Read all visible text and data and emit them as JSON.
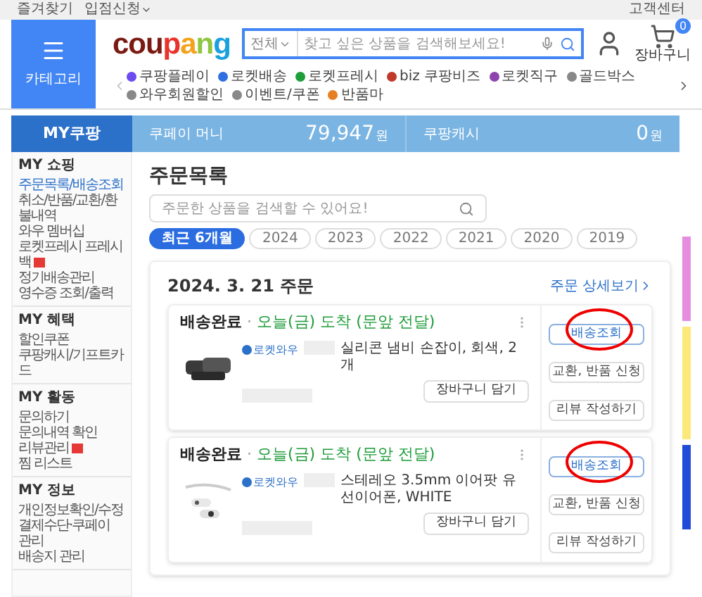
{
  "top_bar": {
    "links": [
      "즐겨찾기",
      "입점신청"
    ],
    "right": "고객센터"
  },
  "header": {
    "menu_label": "카테고리",
    "logo": "coupang",
    "search": {
      "category": "전체",
      "placeholder": "찾고 싶은 상품을 검색해보세요!"
    },
    "cart": {
      "label": "장바구니",
      "badge": "0"
    },
    "nav": [
      "쿠팡플레이",
      "로켓배송",
      "로켓프레시",
      "biz 쿠팡비즈",
      "로켓직구",
      "골드박스",
      "와우회원할인",
      "이벤트/쿠폰",
      "반품마"
    ]
  },
  "my_bar": {
    "title": "MY쿠팡",
    "stats": [
      {
        "label": "쿠페이 머니",
        "value": "79,947",
        "unit": "원"
      },
      {
        "label": "쿠팡캐시",
        "value": "0",
        "unit": "원"
      }
    ]
  },
  "sidebar": [
    {
      "title": "MY 쇼핑",
      "items": [
        {
          "label": "주문목록/배송조회",
          "selected": true,
          "new": false
        },
        {
          "label": "취소/반품/교환/환불내역",
          "selected": false,
          "new": false
        },
        {
          "label": "와우 멤버십",
          "selected": false,
          "new": false
        },
        {
          "label": "로켓프레시 프레시백",
          "selected": false,
          "new": true
        },
        {
          "label": "정기배송관리",
          "selected": false,
          "new": false
        },
        {
          "label": "영수증 조회/출력",
          "selected": false,
          "new": false
        }
      ]
    },
    {
      "title": "MY 혜택",
      "items": [
        {
          "label": "할인쿠폰",
          "selected": false,
          "new": false
        },
        {
          "label": "쿠팡캐시/기프트카드",
          "selected": false,
          "new": false
        }
      ]
    },
    {
      "title": "MY 활동",
      "items": [
        {
          "label": "문의하기",
          "selected": false,
          "new": false
        },
        {
          "label": "문의내역 확인",
          "selected": false,
          "new": false
        },
        {
          "label": "리뷰관리",
          "selected": false,
          "new": true
        },
        {
          "label": "찜 리스트",
          "selected": false,
          "new": false
        }
      ]
    },
    {
      "title": "MY 정보",
      "items": [
        {
          "label": "개인정보확인/수정",
          "selected": false,
          "new": false
        },
        {
          "label": "결제수단·쿠페이 관리",
          "selected": false,
          "new": false
        },
        {
          "label": "배송지 관리",
          "selected": false,
          "new": false
        }
      ]
    }
  ],
  "orders": {
    "title": "주문목록",
    "search_placeholder": "주문한 상품을 검색할 수 있어요!",
    "periods": [
      {
        "label": "최근 6개월",
        "selected": true
      },
      {
        "label": "2024",
        "selected": false
      },
      {
        "label": "2023",
        "selected": false
      },
      {
        "label": "2022",
        "selected": false
      },
      {
        "label": "2021",
        "selected": false
      },
      {
        "label": "2020",
        "selected": false
      },
      {
        "label": "2019",
        "selected": false
      }
    ],
    "groups": [
      {
        "date": "2024. 3. 21 주문",
        "detail_link": "주문 상세보기",
        "items": [
          {
            "status": "배송완료",
            "separator": "·",
            "arrival": "오늘(금) 도착 (문앞 전달)",
            "badge": "로켓와우",
            "name": "실리콘 냄비 손잡이, 회색, 2개",
            "cart_button": "장바구니 담기",
            "actions": [
              {
                "label": "배송조회",
                "highlighted": true
              },
              {
                "label": "교환, 반품 신청",
                "highlighted": false
              },
              {
                "label": "리뷰 작성하기",
                "highlighted": false
              }
            ]
          },
          {
            "status": "배송완료",
            "separator": "·",
            "arrival": "오늘(금) 도착 (문앞 전달)",
            "badge": "로켓와우",
            "name": "스테레오 3.5mm 이어팟 유선이어폰, WHITE",
            "cart_button": "장바구니 담기",
            "actions": [
              {
                "label": "배송조회",
                "highlighted": true
              },
              {
                "label": "교환, 반품 신청",
                "highlighted": false
              },
              {
                "label": "리뷰 작성하기",
                "highlighted": false
              }
            ]
          }
        ]
      }
    ]
  }
}
